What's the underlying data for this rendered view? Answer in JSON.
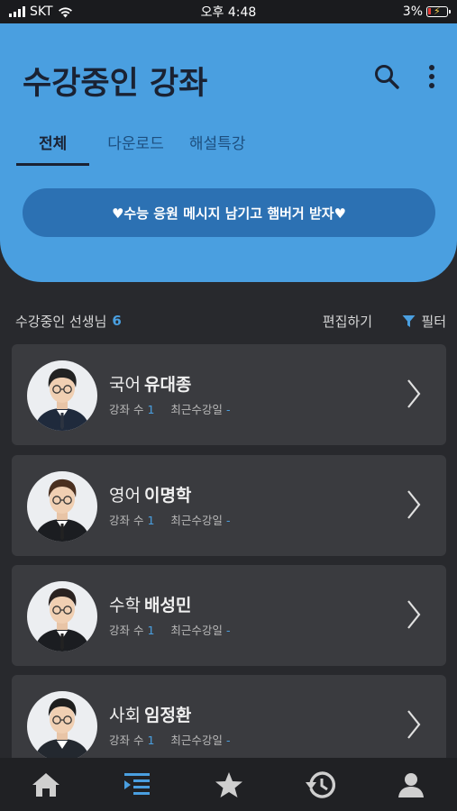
{
  "status_bar": {
    "carrier": "SKT",
    "time": "오후 4:48",
    "battery": "3%"
  },
  "header": {
    "title": "수강중인 강좌",
    "tabs": [
      {
        "label": "전체",
        "active": true
      },
      {
        "label": "다운로드",
        "active": false
      },
      {
        "label": "해설특강",
        "active": false
      }
    ],
    "promo": "♥수능 응원 메시지 남기고 햄버거 받자♥"
  },
  "list_header": {
    "label": "수강중인 선생님",
    "count": "6",
    "edit": "편집하기",
    "filter": "필터"
  },
  "teachers": [
    {
      "subject": "국어",
      "name": "유대종",
      "count_label": "강좌 수",
      "count": "1",
      "recent_label": "최근수강일",
      "recent": "-"
    },
    {
      "subject": "영어",
      "name": "이명학",
      "count_label": "강좌 수",
      "count": "1",
      "recent_label": "최근수강일",
      "recent": "-"
    },
    {
      "subject": "수학",
      "name": "배성민",
      "count_label": "강좌 수",
      "count": "1",
      "recent_label": "최근수강일",
      "recent": "-"
    },
    {
      "subject": "사회",
      "name": "임정환",
      "count_label": "강좌 수",
      "count": "1",
      "recent_label": "최근수강일",
      "recent": "-"
    }
  ],
  "tab_bar": [
    {
      "icon": "home-icon",
      "active": false
    },
    {
      "icon": "course-list-icon",
      "active": true
    },
    {
      "icon": "star-icon",
      "active": false
    },
    {
      "icon": "history-icon",
      "active": false
    },
    {
      "icon": "profile-icon",
      "active": false
    }
  ],
  "colors": {
    "accent": "#4a9fe0",
    "background": "#28292d",
    "card": "#3a3b3f",
    "promo": "#2c71b3"
  }
}
